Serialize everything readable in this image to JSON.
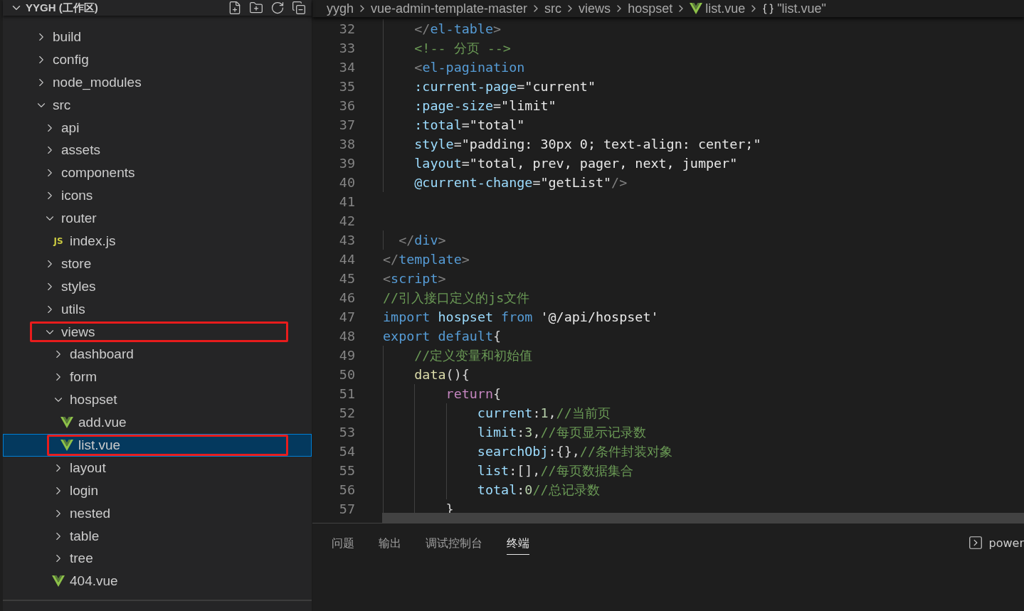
{
  "explorer": {
    "title": "YYGH (工作区)",
    "expanded": true,
    "items": [
      {
        "label": "build",
        "kind": "folder",
        "expanded": false,
        "selected": false,
        "annotated": false
      },
      {
        "label": "config",
        "kind": "folder",
        "expanded": false,
        "selected": false,
        "annotated": false
      },
      {
        "label": "node_modules",
        "kind": "folder",
        "expanded": false,
        "selected": false,
        "annotated": false
      },
      {
        "label": "src",
        "kind": "folder",
        "expanded": true,
        "selected": false,
        "annotated": false,
        "children": [
          {
            "label": "api",
            "kind": "folder",
            "expanded": false,
            "selected": false,
            "annotated": false
          },
          {
            "label": "assets",
            "kind": "folder",
            "expanded": false,
            "selected": false,
            "annotated": false
          },
          {
            "label": "components",
            "kind": "folder",
            "expanded": false,
            "selected": false,
            "annotated": false
          },
          {
            "label": "icons",
            "kind": "folder",
            "expanded": false,
            "selected": false,
            "annotated": false
          },
          {
            "label": "router",
            "kind": "folder",
            "expanded": true,
            "selected": false,
            "annotated": false,
            "children": [
              {
                "label": "index.js",
                "kind": "js",
                "icon_text": "JS",
                "selected": false,
                "annotated": false
              }
            ]
          },
          {
            "label": "store",
            "kind": "folder",
            "expanded": false,
            "selected": false,
            "annotated": false
          },
          {
            "label": "styles",
            "kind": "folder",
            "expanded": false,
            "selected": false,
            "annotated": false
          },
          {
            "label": "utils",
            "kind": "folder",
            "expanded": false,
            "selected": false,
            "annotated": false
          },
          {
            "label": "views",
            "kind": "folder",
            "expanded": true,
            "selected": false,
            "annotated": true,
            "children": [
              {
                "label": "dashboard",
                "kind": "folder",
                "expanded": false,
                "selected": false,
                "annotated": false
              },
              {
                "label": "form",
                "kind": "folder",
                "expanded": false,
                "selected": false,
                "annotated": false
              },
              {
                "label": "hospset",
                "kind": "folder",
                "expanded": true,
                "selected": false,
                "annotated": false,
                "children": [
                  {
                    "label": "add.vue",
                    "kind": "vue",
                    "selected": false,
                    "annotated": false
                  },
                  {
                    "label": "list.vue",
                    "kind": "vue",
                    "selected": true,
                    "annotated": true
                  }
                ]
              },
              {
                "label": "layout",
                "kind": "folder",
                "expanded": false,
                "selected": false,
                "annotated": false
              },
              {
                "label": "login",
                "kind": "folder",
                "expanded": false,
                "selected": false,
                "annotated": false
              },
              {
                "label": "nested",
                "kind": "folder",
                "expanded": false,
                "selected": false,
                "annotated": false
              },
              {
                "label": "table",
                "kind": "folder",
                "expanded": false,
                "selected": false,
                "annotated": false
              },
              {
                "label": "tree",
                "kind": "folder",
                "expanded": false,
                "selected": false,
                "annotated": false
              },
              {
                "label": "404.vue",
                "kind": "vue",
                "selected": false,
                "annotated": false
              }
            ]
          }
        ]
      }
    ]
  },
  "breadcrumb": [
    {
      "label": "yygh",
      "kind": "folder"
    },
    {
      "label": "vue-admin-template-master",
      "kind": "folder"
    },
    {
      "label": "src",
      "kind": "folder"
    },
    {
      "label": "views",
      "kind": "folder"
    },
    {
      "label": "hospset",
      "kind": "folder"
    },
    {
      "label": "list.vue",
      "kind": "vue"
    },
    {
      "label": "\"list.vue\"",
      "kind": "symbol"
    }
  ],
  "code_lines": [
    {
      "number": "32",
      "tokens": [
        {
          "kind": "punct",
          "text": "    </"
        },
        {
          "kind": "tag",
          "text": "el-table"
        },
        {
          "kind": "punct",
          "text": ">"
        }
      ]
    },
    {
      "number": "33",
      "tokens": [
        {
          "kind": "comment",
          "text": "    <!-- 分页 -->"
        }
      ]
    },
    {
      "number": "34",
      "tokens": [
        {
          "kind": "punct",
          "text": "    <"
        },
        {
          "kind": "tag",
          "text": "el-pagination"
        }
      ]
    },
    {
      "number": "35",
      "tokens": [
        {
          "kind": "attr",
          "text": "    :current-page"
        },
        {
          "kind": "plain",
          "text": "="
        },
        {
          "kind": "string",
          "text": "\"current\""
        }
      ]
    },
    {
      "number": "36",
      "tokens": [
        {
          "kind": "attr",
          "text": "    :page-size"
        },
        {
          "kind": "plain",
          "text": "="
        },
        {
          "kind": "string",
          "text": "\"limit\""
        }
      ]
    },
    {
      "number": "37",
      "tokens": [
        {
          "kind": "attr",
          "text": "    :total"
        },
        {
          "kind": "plain",
          "text": "="
        },
        {
          "kind": "string",
          "text": "\"total\""
        }
      ]
    },
    {
      "number": "38",
      "tokens": [
        {
          "kind": "attr",
          "text": "    style"
        },
        {
          "kind": "plain",
          "text": "="
        },
        {
          "kind": "string",
          "text": "\"padding: 30px 0; text-align: center;\""
        }
      ]
    },
    {
      "number": "39",
      "tokens": [
        {
          "kind": "attr",
          "text": "    layout"
        },
        {
          "kind": "plain",
          "text": "="
        },
        {
          "kind": "string",
          "text": "\"total, prev, pager, next, jumper\""
        }
      ]
    },
    {
      "number": "40",
      "tokens": [
        {
          "kind": "attr",
          "text": "    @current-change"
        },
        {
          "kind": "plain",
          "text": "="
        },
        {
          "kind": "string",
          "text": "\"getList\""
        },
        {
          "kind": "punct",
          "text": "/>"
        }
      ]
    },
    {
      "number": "41"
    },
    {
      "number": "42"
    },
    {
      "number": "43",
      "tokens": [
        {
          "kind": "punct",
          "text": "  </"
        },
        {
          "kind": "tag",
          "text": "div"
        },
        {
          "kind": "punct",
          "text": ">"
        }
      ]
    },
    {
      "number": "44",
      "tokens": [
        {
          "kind": "punct",
          "text": "</"
        },
        {
          "kind": "tag",
          "text": "template"
        },
        {
          "kind": "punct",
          "text": ">"
        }
      ]
    },
    {
      "number": "45",
      "tokens": [
        {
          "kind": "punct",
          "text": "<"
        },
        {
          "kind": "tag",
          "text": "script"
        },
        {
          "kind": "punct",
          "text": ">"
        }
      ]
    },
    {
      "number": "46",
      "tokens": [
        {
          "kind": "comment",
          "text": "//引入接口定义的js文件"
        }
      ]
    },
    {
      "number": "47",
      "tokens": [
        {
          "kind": "keyword",
          "text": "import "
        },
        {
          "kind": "var",
          "text": "hospset "
        },
        {
          "kind": "keyword",
          "text": "from "
        },
        {
          "kind": "string",
          "text": "'@/api/hospset'"
        }
      ]
    },
    {
      "number": "48",
      "tokens": [
        {
          "kind": "keyword",
          "text": "export default"
        },
        {
          "kind": "plain",
          "text": "{"
        }
      ]
    },
    {
      "number": "49",
      "tokens": [
        {
          "kind": "comment",
          "text": "    //定义变量和初始值"
        }
      ]
    },
    {
      "number": "50",
      "tokens": [
        {
          "kind": "fn",
          "text": "    data"
        },
        {
          "kind": "plain",
          "text": "(){"
        }
      ]
    },
    {
      "number": "51",
      "tokens": [
        {
          "kind": "control",
          "text": "        return"
        },
        {
          "kind": "plain",
          "text": "{"
        }
      ]
    },
    {
      "number": "52",
      "tokens": [
        {
          "kind": "var",
          "text": "            current"
        },
        {
          "kind": "plain",
          "text": ":"
        },
        {
          "kind": "number",
          "text": "1"
        },
        {
          "kind": "plain",
          "text": ","
        },
        {
          "kind": "comment",
          "text": "//当前页"
        }
      ]
    },
    {
      "number": "53",
      "tokens": [
        {
          "kind": "var",
          "text": "            limit"
        },
        {
          "kind": "plain",
          "text": ":"
        },
        {
          "kind": "number",
          "text": "3"
        },
        {
          "kind": "plain",
          "text": ","
        },
        {
          "kind": "comment",
          "text": "//每页显示记录数"
        }
      ]
    },
    {
      "number": "54",
      "tokens": [
        {
          "kind": "var",
          "text": "            searchObj"
        },
        {
          "kind": "plain",
          "text": ":{},"
        },
        {
          "kind": "comment",
          "text": "//条件封装对象"
        }
      ]
    },
    {
      "number": "55",
      "tokens": [
        {
          "kind": "var",
          "text": "            list"
        },
        {
          "kind": "plain",
          "text": ":[],"
        },
        {
          "kind": "comment",
          "text": "//每页数据集合"
        }
      ]
    },
    {
      "number": "56",
      "tokens": [
        {
          "kind": "var",
          "text": "            total"
        },
        {
          "kind": "plain",
          "text": ":"
        },
        {
          "kind": "number",
          "text": "0"
        },
        {
          "kind": "comment",
          "text": "//总记录数"
        }
      ]
    },
    {
      "number": "57",
      "tokens": [
        {
          "kind": "plain",
          "text": "        }"
        }
      ]
    }
  ],
  "panel": {
    "tabs": [
      {
        "label": "问题",
        "selected": false
      },
      {
        "label": "输出",
        "selected": false
      },
      {
        "label": "调试控制台",
        "selected": false
      },
      {
        "label": "终端",
        "selected": true
      }
    ],
    "terminal": {
      "label": "power"
    }
  }
}
